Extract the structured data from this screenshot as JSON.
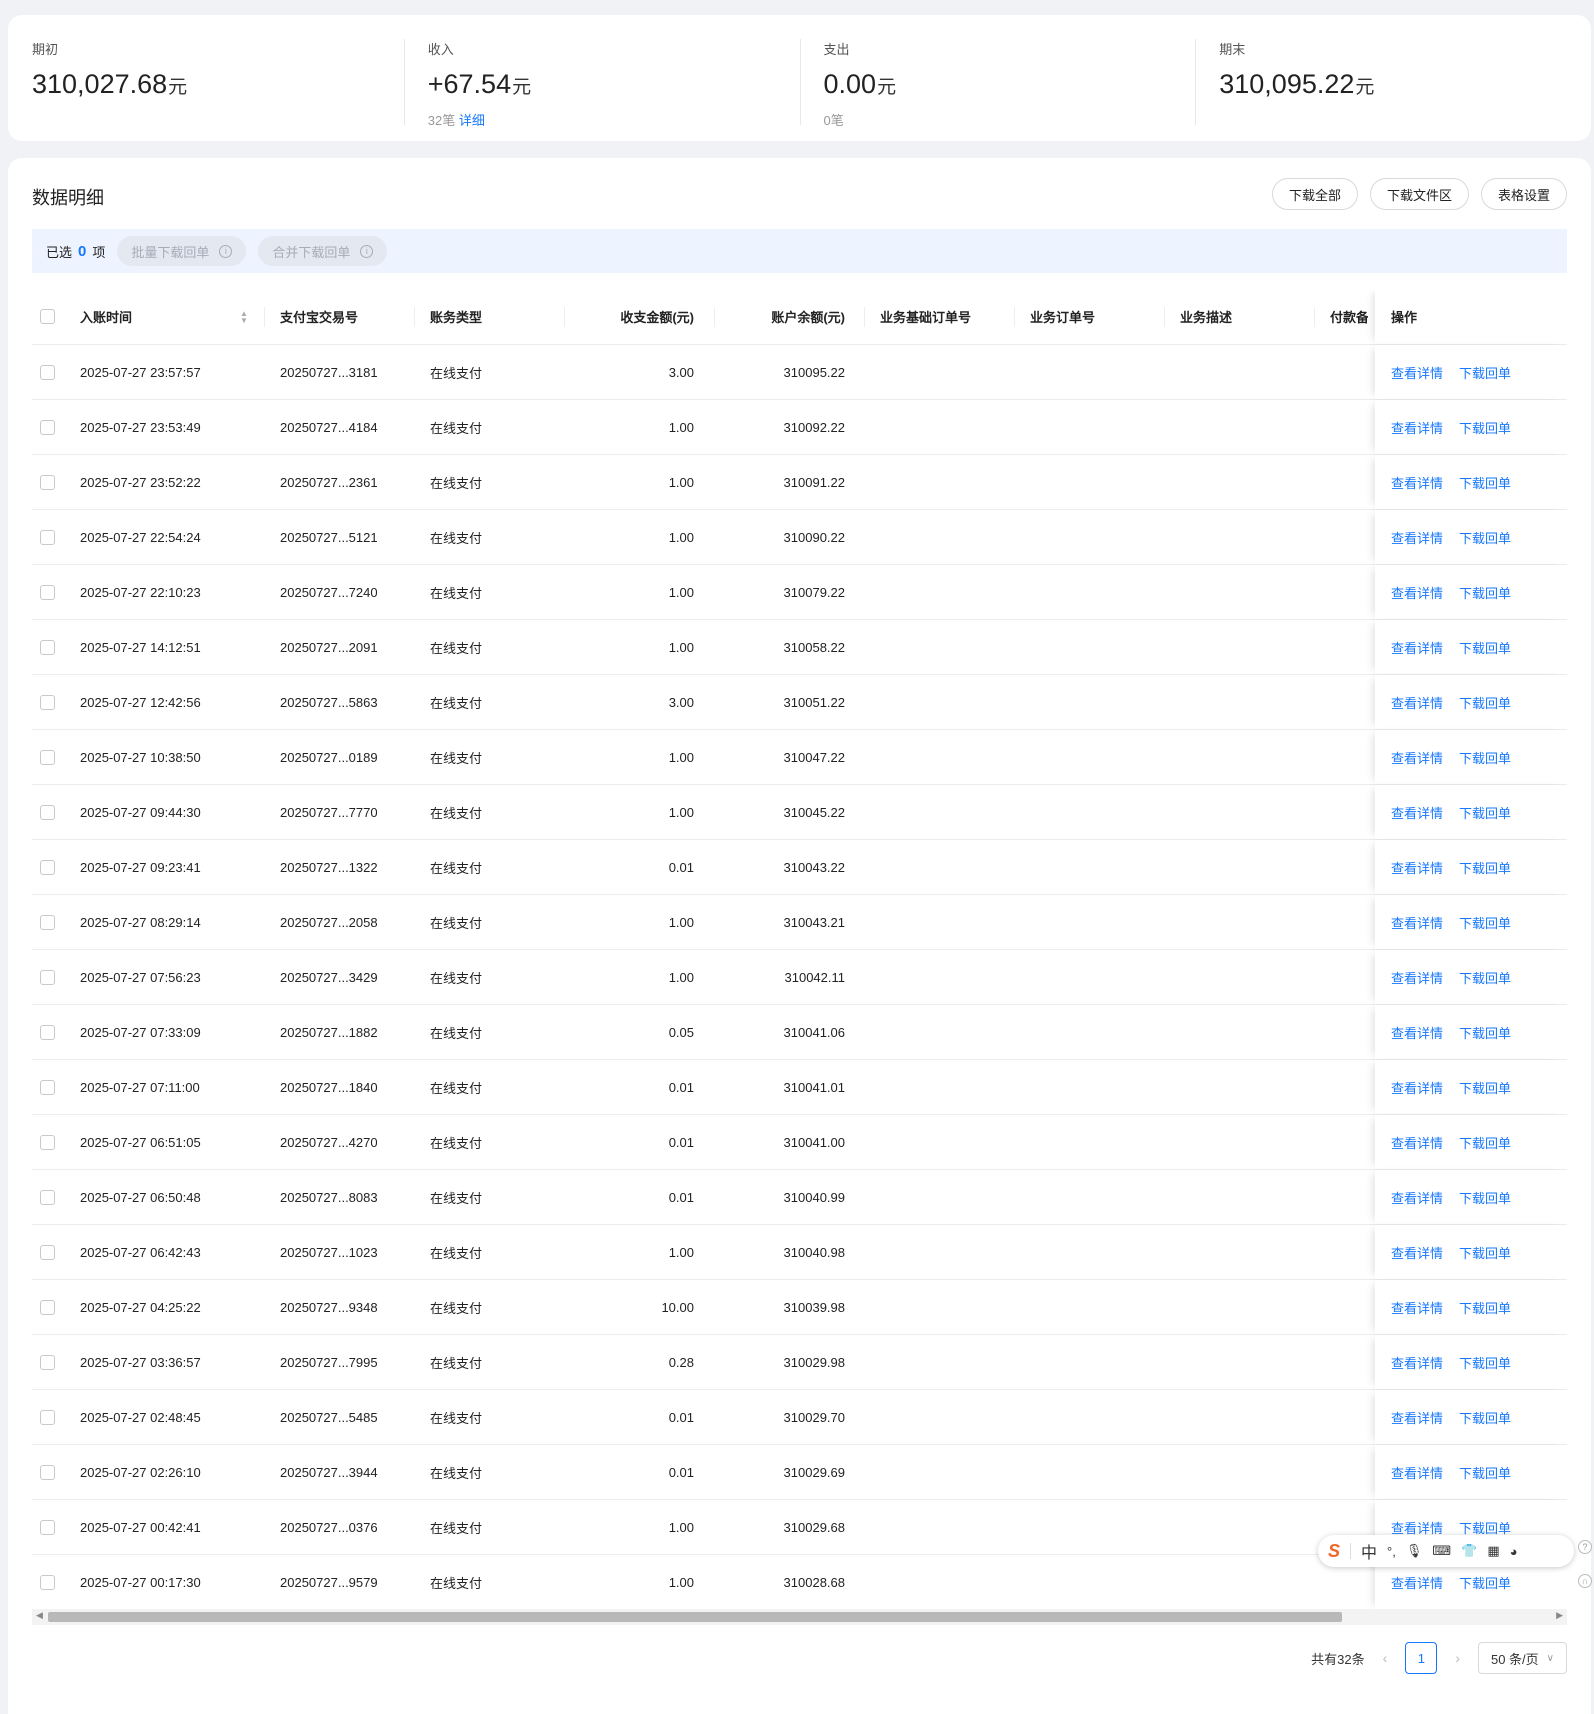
{
  "summary": {
    "opening": {
      "label": "期初",
      "value": "310,027.68",
      "unit": "元"
    },
    "income": {
      "label": "收入",
      "value": "+67.54",
      "unit": "元",
      "count": "32笔",
      "detail_link": "详细"
    },
    "expense": {
      "label": "支出",
      "value": "0.00",
      "unit": "元",
      "count": "0笔"
    },
    "closing": {
      "label": "期末",
      "value": "310,095.22",
      "unit": "元"
    }
  },
  "detail": {
    "title": "数据明细",
    "toolbar": {
      "download_all": "下载全部",
      "download_center": "下载文件区",
      "table_settings": "表格设置"
    },
    "selection": {
      "prefix": "已选",
      "count": "0",
      "suffix": "项",
      "batch_download": "批量下载回单",
      "merge_download": "合并下载回单"
    }
  },
  "table": {
    "headers": {
      "time": "入账时间",
      "trade_no": "支付宝交易号",
      "type": "账务类型",
      "amount": "收支金额(元)",
      "balance": "账户余额(元)",
      "base_order": "业务基础订单号",
      "order": "业务订单号",
      "desc": "业务描述",
      "payer": "付款备注",
      "ops": "操作"
    },
    "op_view": "查看详情",
    "op_download": "下载回单",
    "rows": [
      {
        "time": "2025-07-27 23:57:57",
        "trade_no": "20250727...3181",
        "type": "在线支付",
        "amount": "3.00",
        "balance": "310095.22"
      },
      {
        "time": "2025-07-27 23:53:49",
        "trade_no": "20250727...4184",
        "type": "在线支付",
        "amount": "1.00",
        "balance": "310092.22"
      },
      {
        "time": "2025-07-27 23:52:22",
        "trade_no": "20250727...2361",
        "type": "在线支付",
        "amount": "1.00",
        "balance": "310091.22"
      },
      {
        "time": "2025-07-27 22:54:24",
        "trade_no": "20250727...5121",
        "type": "在线支付",
        "amount": "1.00",
        "balance": "310090.22"
      },
      {
        "time": "2025-07-27 22:10:23",
        "trade_no": "20250727...7240",
        "type": "在线支付",
        "amount": "1.00",
        "balance": "310079.22"
      },
      {
        "time": "2025-07-27 14:12:51",
        "trade_no": "20250727...2091",
        "type": "在线支付",
        "amount": "1.00",
        "balance": "310058.22"
      },
      {
        "time": "2025-07-27 12:42:56",
        "trade_no": "20250727...5863",
        "type": "在线支付",
        "amount": "3.00",
        "balance": "310051.22"
      },
      {
        "time": "2025-07-27 10:38:50",
        "trade_no": "20250727...0189",
        "type": "在线支付",
        "amount": "1.00",
        "balance": "310047.22"
      },
      {
        "time": "2025-07-27 09:44:30",
        "trade_no": "20250727...7770",
        "type": "在线支付",
        "amount": "1.00",
        "balance": "310045.22"
      },
      {
        "time": "2025-07-27 09:23:41",
        "trade_no": "20250727...1322",
        "type": "在线支付",
        "amount": "0.01",
        "balance": "310043.22"
      },
      {
        "time": "2025-07-27 08:29:14",
        "trade_no": "20250727...2058",
        "type": "在线支付",
        "amount": "1.00",
        "balance": "310043.21"
      },
      {
        "time": "2025-07-27 07:56:23",
        "trade_no": "20250727...3429",
        "type": "在线支付",
        "amount": "1.00",
        "balance": "310042.11"
      },
      {
        "time": "2025-07-27 07:33:09",
        "trade_no": "20250727...1882",
        "type": "在线支付",
        "amount": "0.05",
        "balance": "310041.06"
      },
      {
        "time": "2025-07-27 07:11:00",
        "trade_no": "20250727...1840",
        "type": "在线支付",
        "amount": "0.01",
        "balance": "310041.01"
      },
      {
        "time": "2025-07-27 06:51:05",
        "trade_no": "20250727...4270",
        "type": "在线支付",
        "amount": "0.01",
        "balance": "310041.00"
      },
      {
        "time": "2025-07-27 06:50:48",
        "trade_no": "20250727...8083",
        "type": "在线支付",
        "amount": "0.01",
        "balance": "310040.99"
      },
      {
        "time": "2025-07-27 06:42:43",
        "trade_no": "20250727...1023",
        "type": "在线支付",
        "amount": "1.00",
        "balance": "310040.98"
      },
      {
        "time": "2025-07-27 04:25:22",
        "trade_no": "20250727...9348",
        "type": "在线支付",
        "amount": "10.00",
        "balance": "310039.98"
      },
      {
        "time": "2025-07-27 03:36:57",
        "trade_no": "20250727...7995",
        "type": "在线支付",
        "amount": "0.28",
        "balance": "310029.98"
      },
      {
        "time": "2025-07-27 02:48:45",
        "trade_no": "20250727...5485",
        "type": "在线支付",
        "amount": "0.01",
        "balance": "310029.70"
      },
      {
        "time": "2025-07-27 02:26:10",
        "trade_no": "20250727...3944",
        "type": "在线支付",
        "amount": "0.01",
        "balance": "310029.69"
      },
      {
        "time": "2025-07-27 00:42:41",
        "trade_no": "20250727...0376",
        "type": "在线支付",
        "amount": "1.00",
        "balance": "310029.68"
      },
      {
        "time": "2025-07-27 00:17:30",
        "trade_no": "20250727...9579",
        "type": "在线支付",
        "amount": "1.00",
        "balance": "310028.68"
      }
    ]
  },
  "pagination": {
    "total": "共有32条",
    "current_page": "1",
    "page_size": "50 条/页"
  },
  "ime": {
    "logo": "S",
    "mode": "中"
  },
  "colors": {
    "accent": "#1677ff",
    "background": "#f0f2f5"
  }
}
